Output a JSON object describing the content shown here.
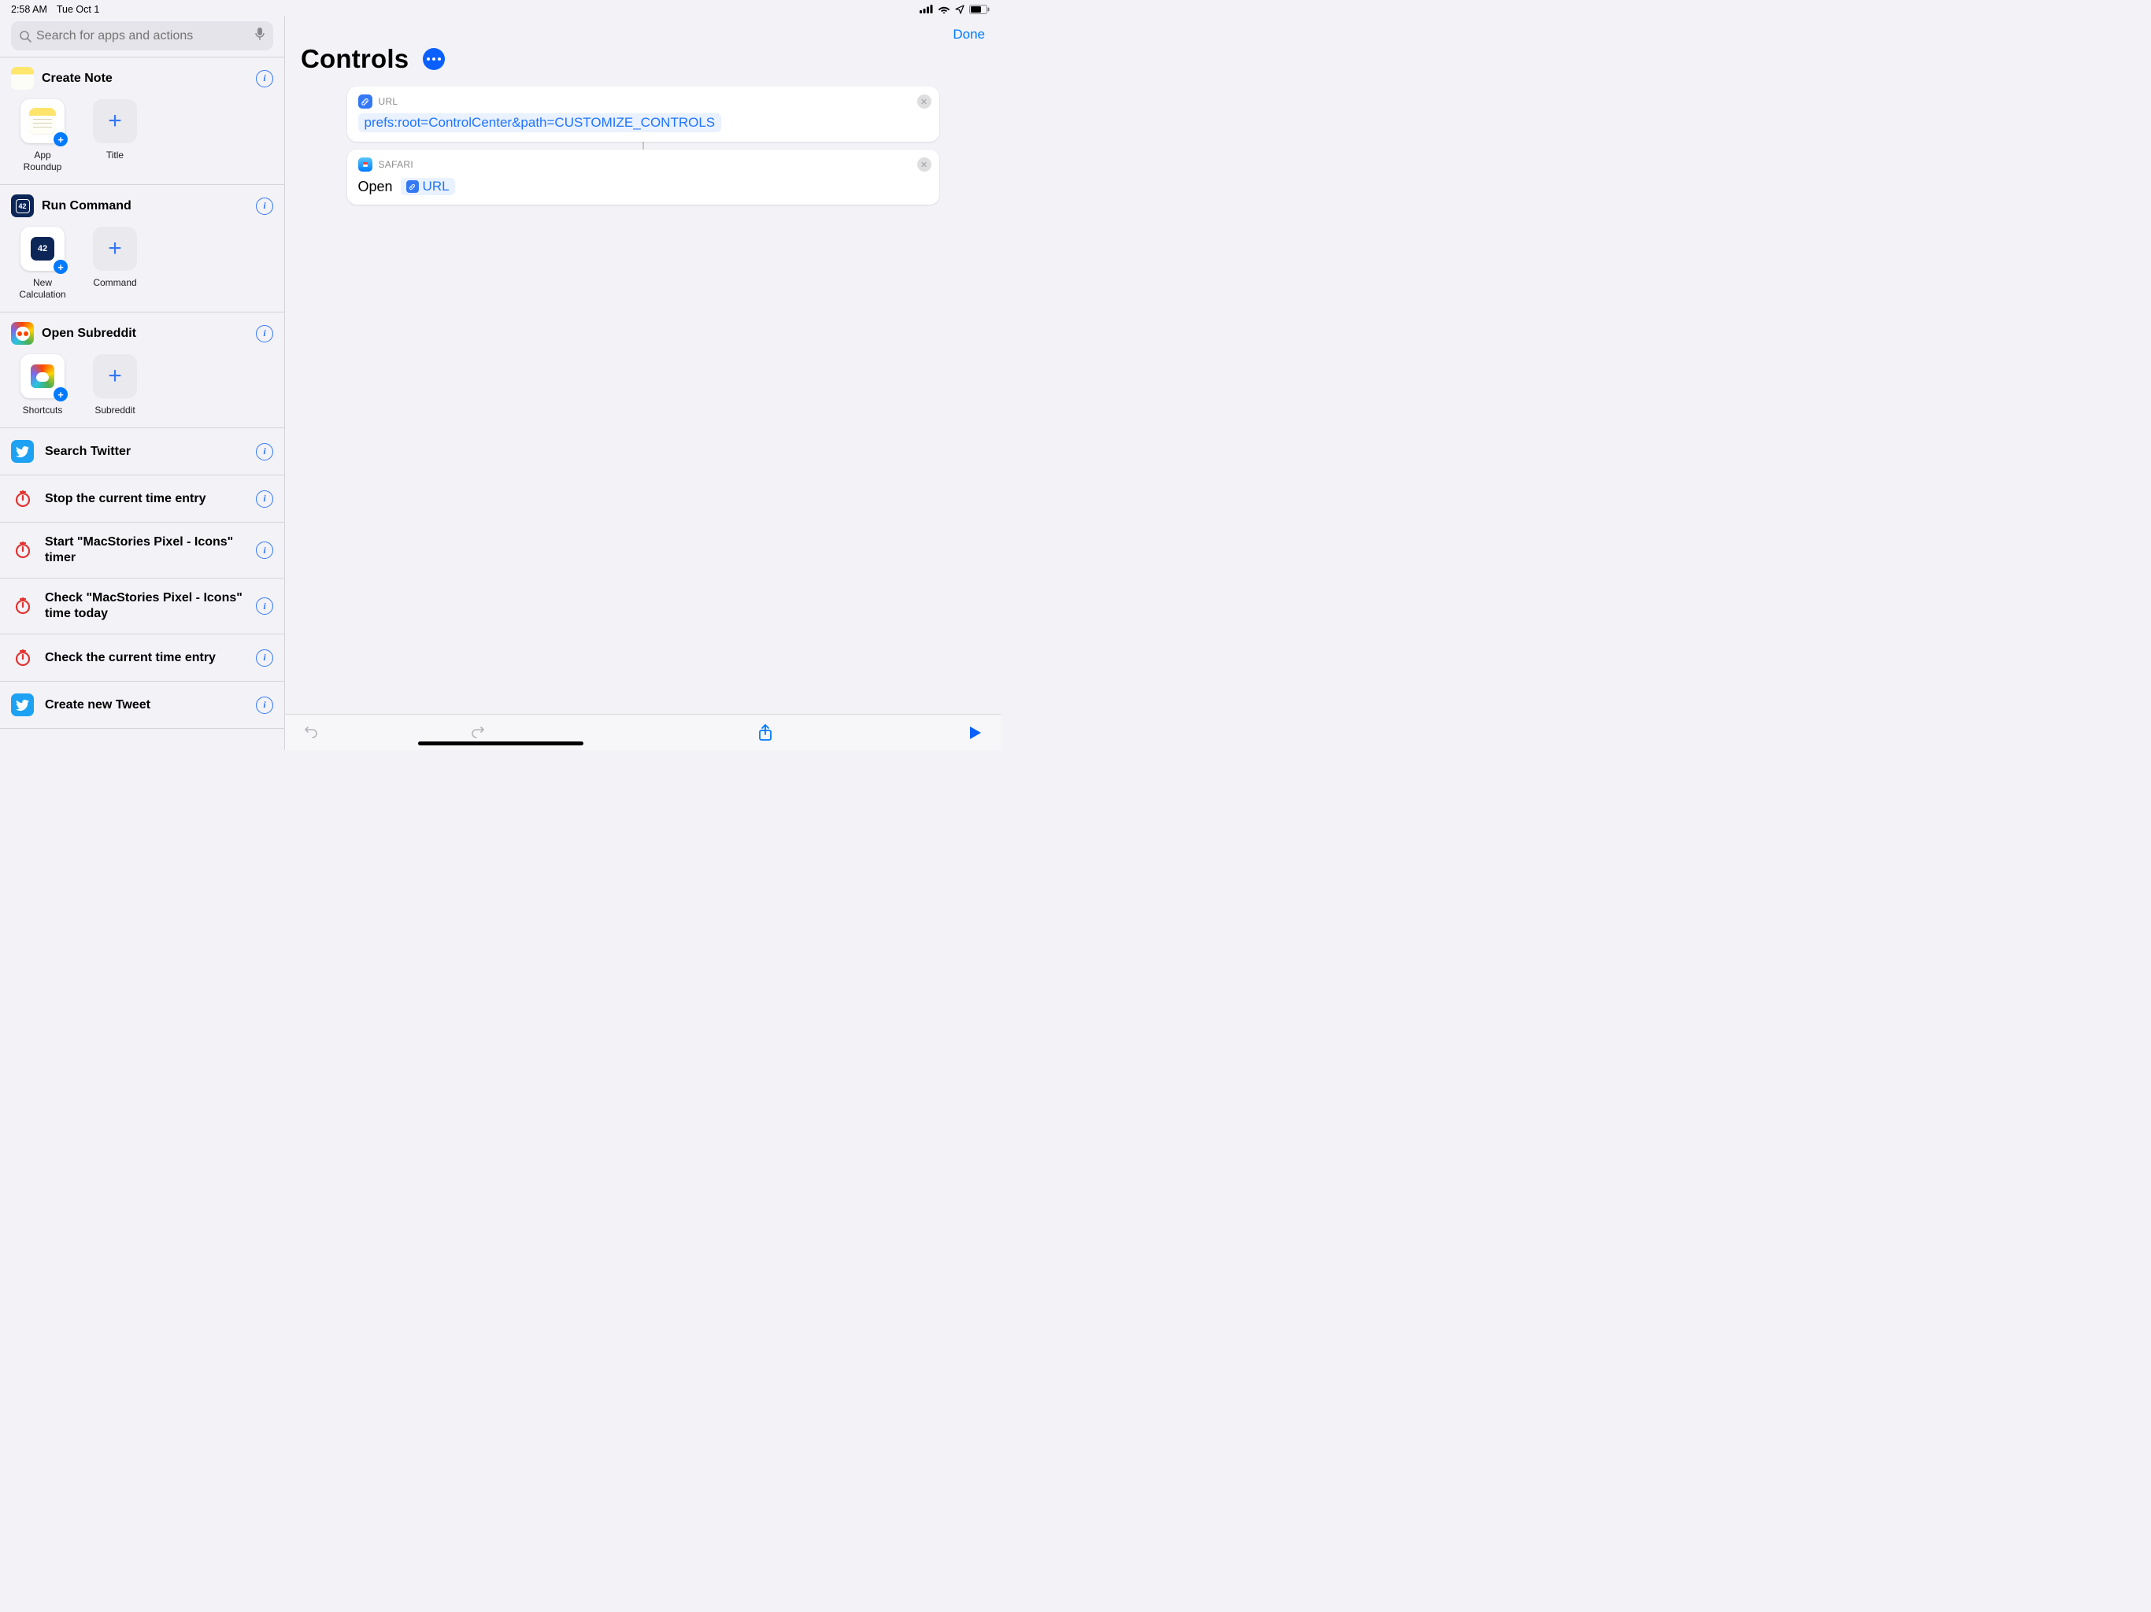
{
  "status": {
    "time": "2:58 AM",
    "date": "Tue Oct 1"
  },
  "search": {
    "placeholder": "Search for apps and actions"
  },
  "sections": [
    {
      "icon": "notes",
      "title": "Create Note",
      "tiles": [
        {
          "kind": "app",
          "icon": "notes-tile",
          "label": "App Roundup",
          "badge": true
        },
        {
          "kind": "add",
          "label": "Title"
        }
      ]
    },
    {
      "icon": "42",
      "title": "Run Command",
      "tiles": [
        {
          "kind": "app",
          "icon": "pcalc",
          "label": "New Calculation",
          "badge": true
        },
        {
          "kind": "add",
          "label": "Command"
        }
      ]
    },
    {
      "icon": "reddit",
      "title": "Open Subreddit",
      "tiles": [
        {
          "kind": "app",
          "icon": "reddit-tile",
          "label": "Shortcuts",
          "badge": true
        },
        {
          "kind": "add",
          "label": "Subreddit"
        }
      ]
    }
  ],
  "rows": [
    {
      "icon": "twitter",
      "label": "Search Twitter"
    },
    {
      "icon": "toggl",
      "label": "Stop the current time entry"
    },
    {
      "icon": "toggl",
      "label": "Start \"MacStories Pixel - Icons\" timer"
    },
    {
      "icon": "toggl",
      "label": "Check \"MacStories Pixel - Icons\" time today"
    },
    {
      "icon": "toggl",
      "label": "Check the current time entry"
    },
    {
      "icon": "twitter",
      "label": "Create new Tweet"
    }
  ],
  "header": {
    "done": "Done",
    "title": "Controls"
  },
  "actions": {
    "url_card": {
      "header": "URL",
      "value": "prefs:root=ControlCenter&path=CUSTOMIZE_CONTROLS"
    },
    "open_card": {
      "header": "SAFARI",
      "verb": "Open",
      "token": "URL"
    }
  }
}
